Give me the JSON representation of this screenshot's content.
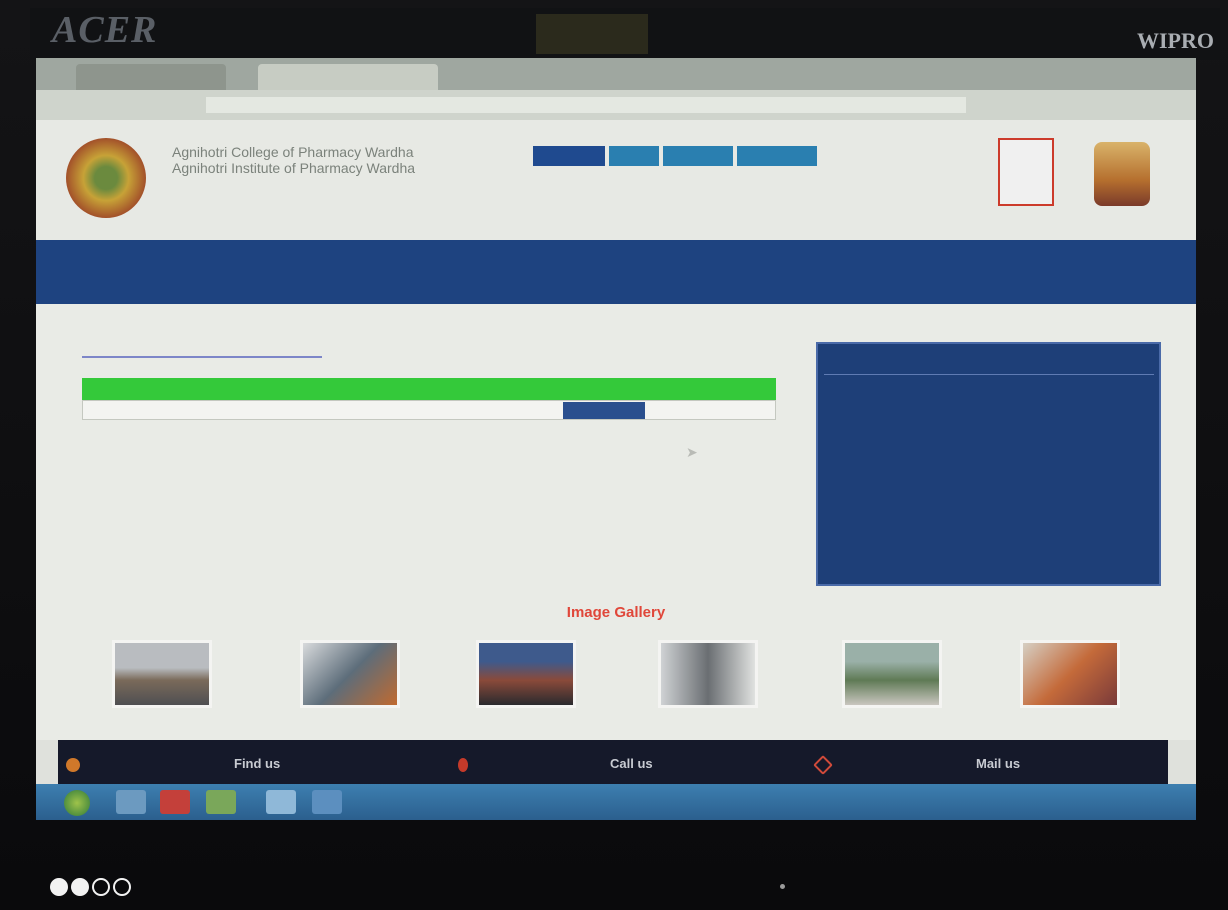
{
  "monitor": {
    "brand_left": "ACER",
    "brand_center": "",
    "brand_right": "WIPRO"
  },
  "browser": {
    "tab_title": "",
    "address": ""
  },
  "header": {
    "college_line1": "Agnihotri College of Pharmacy Wardha",
    "college_line2": "Agnihotri Institute of Pharmacy Wardha",
    "buttons": [
      "",
      "",
      "",
      ""
    ],
    "contact_phone": "",
    "contact_email": "",
    "badge_text": ""
  },
  "nav": {
    "items": [
      "",
      "",
      "",
      "",
      "",
      "",
      "",
      "",
      "",
      "",
      "",
      "",
      "",
      "",
      "",
      ""
    ]
  },
  "content": {
    "page_title": "",
    "table": {
      "headers": [
        "",
        "",
        ""
      ],
      "rows": [
        {
          "sr": "",
          "name": "",
          "view_label": ""
        }
      ]
    }
  },
  "quick_links": {
    "title": "",
    "items": [
      "",
      "",
      "",
      "",
      "",
      ""
    ]
  },
  "gallery": {
    "title": "Image Gallery",
    "thumb_count": 6
  },
  "footer": {
    "find": "Find us",
    "call": "Call us",
    "mail": "Mail us"
  },
  "taskbar": {
    "time": "",
    "date": ""
  },
  "slider": {
    "total": 4,
    "active": 2
  },
  "colors": {
    "nav": "#1e4380",
    "table_header": "#34c93a",
    "accent_red": "#e0473a",
    "quick_panel": "#1e3f78"
  }
}
